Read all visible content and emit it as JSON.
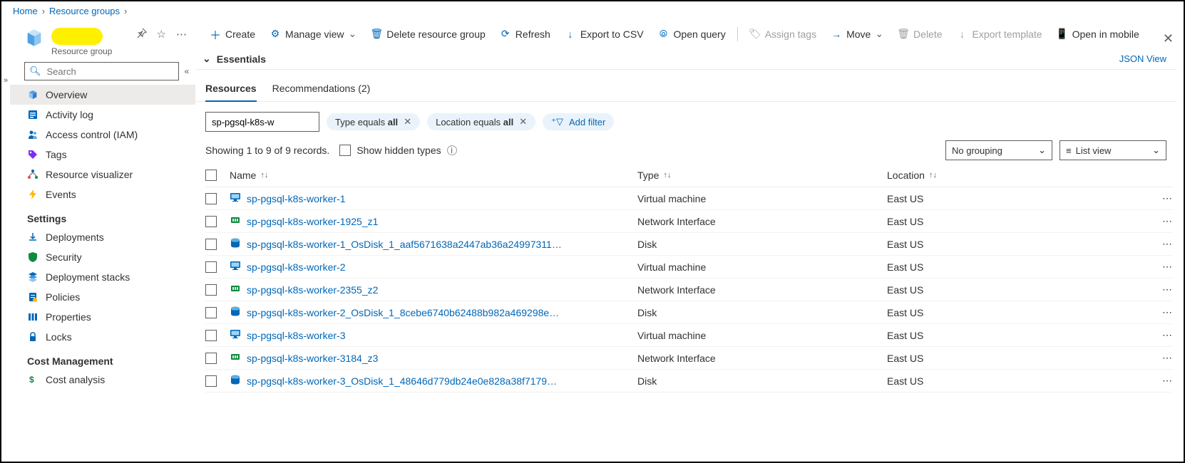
{
  "breadcrumb": {
    "home": "Home",
    "rg": "Resource groups"
  },
  "header": {
    "subtitle": "Resource group",
    "search_placeholder": "Search"
  },
  "nav": {
    "overview": "Overview",
    "activity": "Activity log",
    "iam": "Access control (IAM)",
    "tags": "Tags",
    "visualizer": "Resource visualizer",
    "events": "Events",
    "section_settings": "Settings",
    "deployments": "Deployments",
    "security": "Security",
    "stacks": "Deployment stacks",
    "policies": "Policies",
    "properties": "Properties",
    "locks": "Locks",
    "section_cost": "Cost Management",
    "cost_analysis": "Cost analysis"
  },
  "toolbar": {
    "create": "Create",
    "manage_view": "Manage view",
    "delete_rg": "Delete resource group",
    "refresh": "Refresh",
    "export_csv": "Export to CSV",
    "open_query": "Open query",
    "assign_tags": "Assign tags",
    "move": "Move",
    "delete": "Delete",
    "export_tpl": "Export template",
    "open_mobile": "Open in mobile"
  },
  "essentials": {
    "label": "Essentials",
    "json_view": "JSON View"
  },
  "tabs": {
    "resources": "Resources",
    "recommendations": "Recommendations (2)"
  },
  "filters": {
    "search_value": "sp-pgsql-k8s-w",
    "type_prefix": "Type equals ",
    "type_val": "all",
    "loc_prefix": "Location equals ",
    "loc_val": "all",
    "add_filter": "Add filter"
  },
  "showing": {
    "text": "Showing 1 to 9 of 9 records.",
    "hidden": "Show hidden types",
    "no_grouping": "No grouping",
    "list_view": "List view"
  },
  "columns": {
    "name": "Name",
    "type": "Type",
    "location": "Location"
  },
  "rows": [
    {
      "icon": "vm",
      "name": "sp-pgsql-k8s-worker-1",
      "type": "Virtual machine",
      "loc": "East US"
    },
    {
      "icon": "nic",
      "name": "sp-pgsql-k8s-worker-1925_z1",
      "type": "Network Interface",
      "loc": "East US"
    },
    {
      "icon": "disk",
      "name": "sp-pgsql-k8s-worker-1_OsDisk_1_aaf5671638a2447ab36a24997311…",
      "type": "Disk",
      "loc": "East US"
    },
    {
      "icon": "vm",
      "name": "sp-pgsql-k8s-worker-2",
      "type": "Virtual machine",
      "loc": "East US"
    },
    {
      "icon": "nic",
      "name": "sp-pgsql-k8s-worker-2355_z2",
      "type": "Network Interface",
      "loc": "East US"
    },
    {
      "icon": "disk",
      "name": "sp-pgsql-k8s-worker-2_OsDisk_1_8cebe6740b62488b982a469298e…",
      "type": "Disk",
      "loc": "East US"
    },
    {
      "icon": "vm",
      "name": "sp-pgsql-k8s-worker-3",
      "type": "Virtual machine",
      "loc": "East US"
    },
    {
      "icon": "nic",
      "name": "sp-pgsql-k8s-worker-3184_z3",
      "type": "Network Interface",
      "loc": "East US"
    },
    {
      "icon": "disk",
      "name": "sp-pgsql-k8s-worker-3_OsDisk_1_48646d779db24e0e828a38f7179…",
      "type": "Disk",
      "loc": "East US"
    }
  ]
}
